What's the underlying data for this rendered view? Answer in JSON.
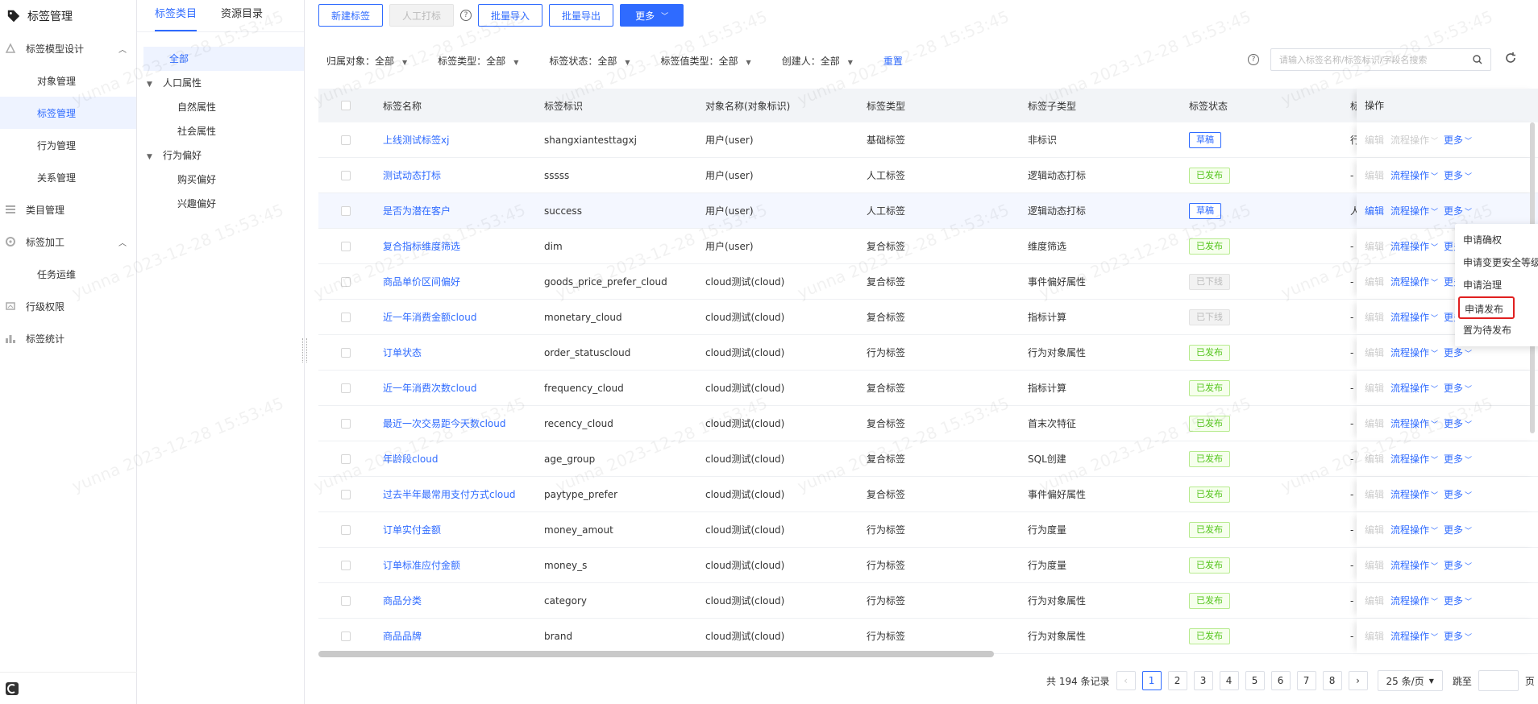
{
  "sidebar": {
    "title": "标签管理",
    "groups": [
      {
        "label": "标签模型设计",
        "icon": "model-icon",
        "expanded": true,
        "items": [
          {
            "label": "对象管理"
          },
          {
            "label": "标签管理",
            "active": true
          },
          {
            "label": "行为管理"
          },
          {
            "label": "关系管理"
          }
        ]
      },
      {
        "label": "类目管理",
        "icon": "list-icon"
      },
      {
        "label": "标签加工",
        "icon": "gear-icon",
        "expanded": true,
        "items": [
          {
            "label": "任务运维"
          }
        ]
      },
      {
        "label": "行级权限",
        "icon": "permission-icon"
      },
      {
        "label": "标签统计",
        "icon": "bar-chart-icon"
      }
    ]
  },
  "category_panel": {
    "tabs": [
      "标签类目",
      "资源目录"
    ],
    "active_tab": "标签类目",
    "tree": {
      "all": "全部",
      "groups": [
        {
          "label": "人口属性",
          "children": [
            "自然属性",
            "社会属性"
          ]
        },
        {
          "label": "行为偏好",
          "children": [
            "购买偏好",
            "兴趣偏好"
          ]
        }
      ]
    }
  },
  "toolbar": {
    "new_tag": "新建标签",
    "manual_tag": "人工打标",
    "batch_import": "批量导入",
    "batch_export": "批量导出",
    "more": "更多"
  },
  "filters": {
    "object": "归属对象：全部",
    "tag_type": "标签类型：全部",
    "tag_status": "标签状态：全部",
    "value_type": "标签值类型：全部",
    "creator": "创建人：全部",
    "reset": "重置",
    "search_placeholder": "请输入标签名称/标签标识/字段名搜索"
  },
  "table": {
    "headers": [
      "标签名称",
      "标签标识",
      "对象名称(对象标识)",
      "标签类型",
      "标签子类型",
      "标签状态",
      "标",
      "操作"
    ],
    "rows": [
      {
        "name": "上线测试标签xj",
        "code": "shangxiantesttagxj",
        "object": "用户(user)",
        "type": "基础标签",
        "subtype": "非标识",
        "status": "草稿",
        "status_kind": "draft",
        "owner": "行",
        "edit_on": false,
        "flow_on": false
      },
      {
        "name": "测试动态打标",
        "code": "sssss",
        "object": "用户(user)",
        "type": "人工标签",
        "subtype": "逻辑动态打标",
        "status": "已发布",
        "status_kind": "published",
        "owner": "-",
        "edit_on": false,
        "flow_on": true
      },
      {
        "name": "是否为潜在客户",
        "code": "success",
        "object": "用户(user)",
        "type": "人工标签",
        "subtype": "逻辑动态打标",
        "status": "草稿",
        "status_kind": "draft",
        "owner": "人",
        "edit_on": true,
        "flow_on": true
      },
      {
        "name": "复合指标维度筛选",
        "code": "dim",
        "object": "用户(user)",
        "type": "复合标签",
        "subtype": "维度筛选",
        "status": "已发布",
        "status_kind": "published",
        "owner": "-",
        "edit_on": false,
        "flow_on": true
      },
      {
        "name": "商品单价区间偏好",
        "code": "goods_price_prefer_cloud",
        "object": "cloud测试(cloud)",
        "type": "复合标签",
        "subtype": "事件偏好属性",
        "status": "已下线",
        "status_kind": "offline",
        "owner": "-",
        "edit_on": false,
        "flow_on": true
      },
      {
        "name": "近一年消费金额cloud",
        "code": "monetary_cloud",
        "object": "cloud测试(cloud)",
        "type": "复合标签",
        "subtype": "指标计算",
        "status": "已下线",
        "status_kind": "offline",
        "owner": "-",
        "edit_on": false,
        "flow_on": true
      },
      {
        "name": "订单状态",
        "code": "order_statuscloud",
        "object": "cloud测试(cloud)",
        "type": "行为标签",
        "subtype": "行为对象属性",
        "status": "已发布",
        "status_kind": "published",
        "owner": "-",
        "edit_on": false,
        "flow_on": true
      },
      {
        "name": "近一年消费次数cloud",
        "code": "frequency_cloud",
        "object": "cloud测试(cloud)",
        "type": "复合标签",
        "subtype": "指标计算",
        "status": "已发布",
        "status_kind": "published",
        "owner": "-",
        "edit_on": false,
        "flow_on": true
      },
      {
        "name": "最近一次交易距今天数cloud",
        "code": "recency_cloud",
        "object": "cloud测试(cloud)",
        "type": "复合标签",
        "subtype": "首末次特征",
        "status": "已发布",
        "status_kind": "published",
        "owner": "-",
        "edit_on": false,
        "flow_on": true
      },
      {
        "name": "年龄段cloud",
        "code": "age_group",
        "object": "cloud测试(cloud)",
        "type": "复合标签",
        "subtype": "SQL创建",
        "status": "已发布",
        "status_kind": "published",
        "owner": "-",
        "edit_on": false,
        "flow_on": true
      },
      {
        "name": "过去半年最常用支付方式cloud",
        "code": "paytype_prefer",
        "object": "cloud测试(cloud)",
        "type": "复合标签",
        "subtype": "事件偏好属性",
        "status": "已发布",
        "status_kind": "published",
        "owner": "-",
        "edit_on": false,
        "flow_on": true
      },
      {
        "name": "订单实付金额",
        "code": "money_amout",
        "object": "cloud测试(cloud)",
        "type": "行为标签",
        "subtype": "行为度量",
        "status": "已发布",
        "status_kind": "published",
        "owner": "-",
        "edit_on": false,
        "flow_on": true
      },
      {
        "name": "订单标准应付金额",
        "code": "money_s",
        "object": "cloud测试(cloud)",
        "type": "行为标签",
        "subtype": "行为度量",
        "status": "已发布",
        "status_kind": "published",
        "owner": "-",
        "edit_on": false,
        "flow_on": true
      },
      {
        "name": "商品分类",
        "code": "category",
        "object": "cloud测试(cloud)",
        "type": "行为标签",
        "subtype": "行为对象属性",
        "status": "已发布",
        "status_kind": "published",
        "owner": "-",
        "edit_on": false,
        "flow_on": true
      },
      {
        "name": "商品品牌",
        "code": "brand",
        "object": "cloud测试(cloud)",
        "type": "行为标签",
        "subtype": "行为对象属性",
        "status": "已发布",
        "status_kind": "published",
        "owner": "-",
        "edit_on": false,
        "flow_on": true
      }
    ],
    "ops": {
      "edit": "编辑",
      "flow": "流程操作",
      "more": "更多"
    }
  },
  "more_menu": {
    "items": [
      "申请确权",
      "申请变更安全等级",
      "申请治理",
      "申请发布",
      "置为待发布"
    ],
    "highlighted": "申请发布"
  },
  "pagination": {
    "total": "共 194 条记录",
    "pages": [
      "1",
      "2",
      "3",
      "4",
      "5",
      "6",
      "7",
      "8"
    ],
    "current": "1",
    "page_size": "25 条/页",
    "jump_label": "跳至",
    "page_suffix": "页"
  },
  "watermark": "yunna 2023-12-28 15:53:45",
  "colors": {
    "accent": "#2f6bff",
    "published": "#52c41a",
    "highlight_border": "#e02020"
  }
}
